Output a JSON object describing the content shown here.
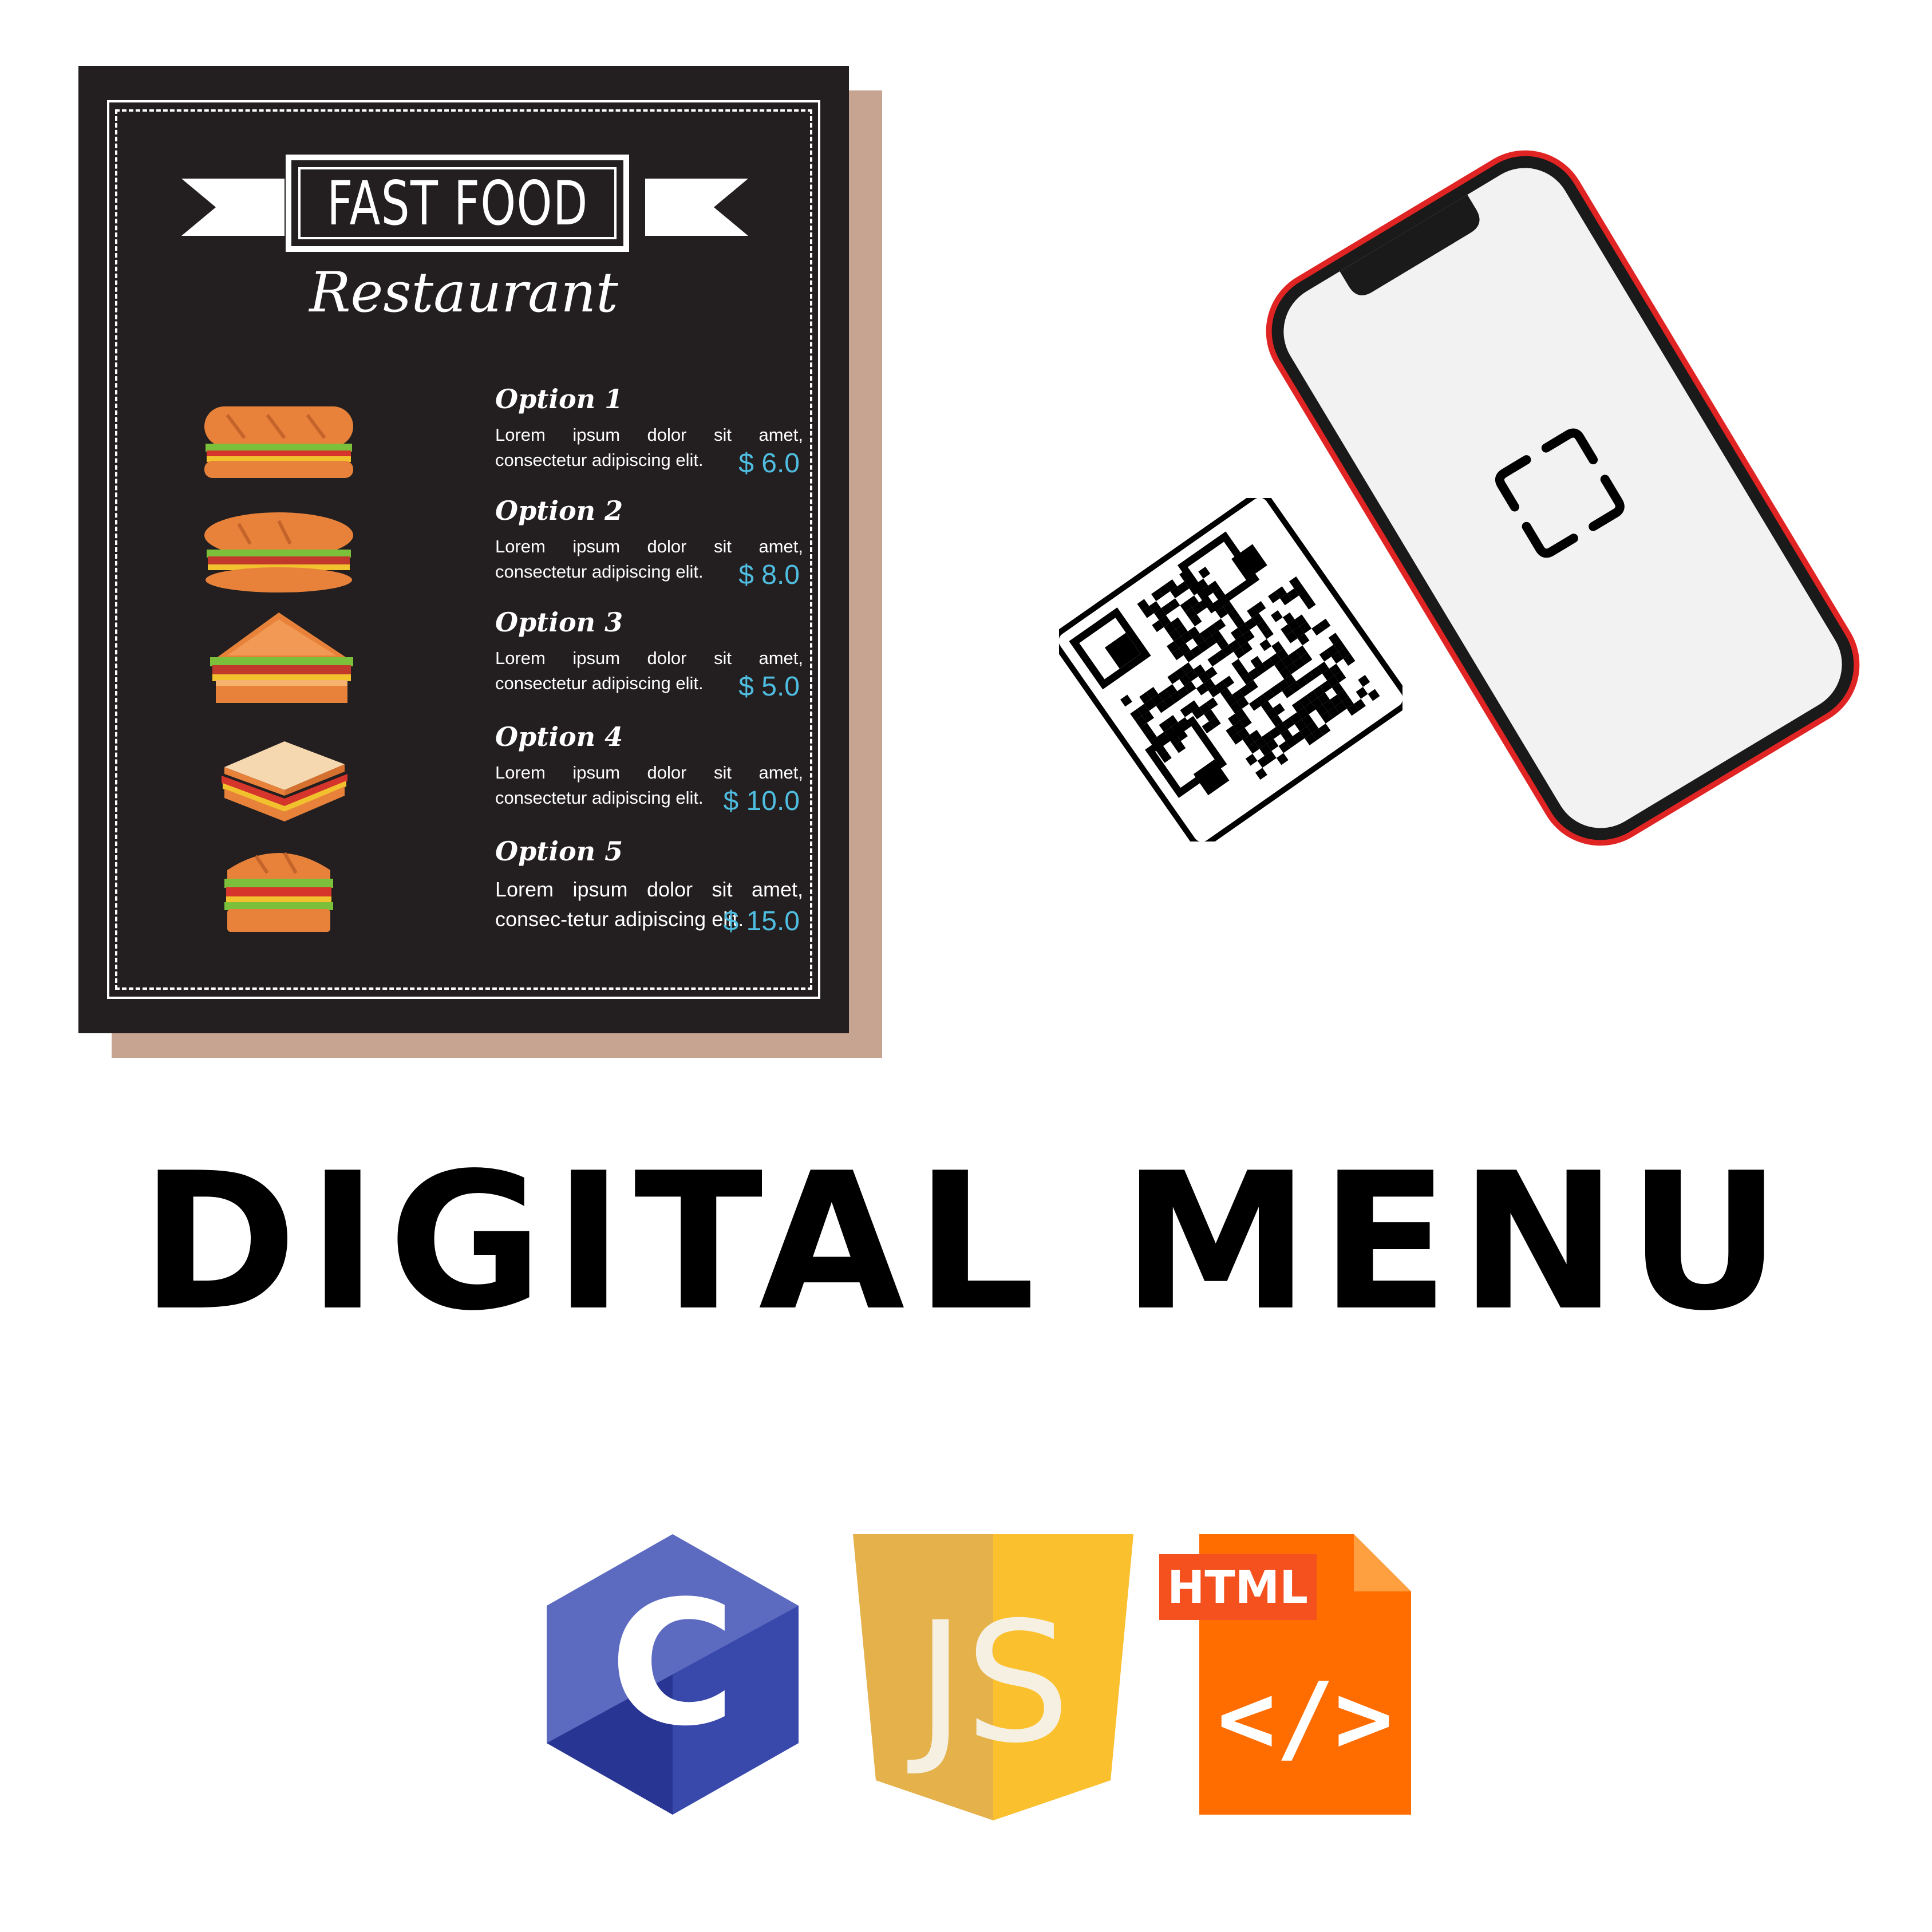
{
  "menu": {
    "title": "FAST FOOD",
    "subtitle": "Restaurant",
    "items": [
      {
        "name": "Option 1",
        "description": "Lorem ipsum dolor sit amet, consectetur adipiscing elit.",
        "price": "$ 6.0",
        "icon": "baguette-sandwich-icon"
      },
      {
        "name": "Option 2",
        "description": "Lorem ipsum dolor sit amet, consectetur adipiscing elit.",
        "price": "$ 8.0",
        "icon": "sub-sandwich-icon"
      },
      {
        "name": "Option 3",
        "description": "Lorem ipsum dolor sit amet, consectetur adipiscing elit.",
        "price": "$ 5.0",
        "icon": "triangle-sandwich-icon"
      },
      {
        "name": "Option 4",
        "description": "Lorem ipsum dolor sit amet, consectetur adipiscing elit.",
        "price": "$ 10.0",
        "icon": "toast-sandwich-icon"
      },
      {
        "name": "Option 5",
        "description": "Lorem ipsum dolor sit amet, consec-tetur adipiscing elit.",
        "price": "$ 15.0",
        "icon": "burger-sandwich-icon"
      }
    ]
  },
  "headline": "DIGITAL MENU",
  "logos": {
    "c_letter": "C",
    "js_letters": "JS",
    "html_label": "HTML",
    "html_tag": "</>"
  },
  "icons": {
    "qr": "qr-code-icon",
    "phone": "smartphone-scanner-icon",
    "c": "c-language-icon",
    "js": "javascript-icon",
    "html": "html-file-icon"
  },
  "colors": {
    "board": "#231f20",
    "shadow": "#c7a392",
    "price": "#4fbde0",
    "phone_frame": "#e02424",
    "c_blue": "#3949ab",
    "js_yellow": "#fbc02d",
    "html_orange": "#ff6d00",
    "html_badge": "#f4511e"
  }
}
